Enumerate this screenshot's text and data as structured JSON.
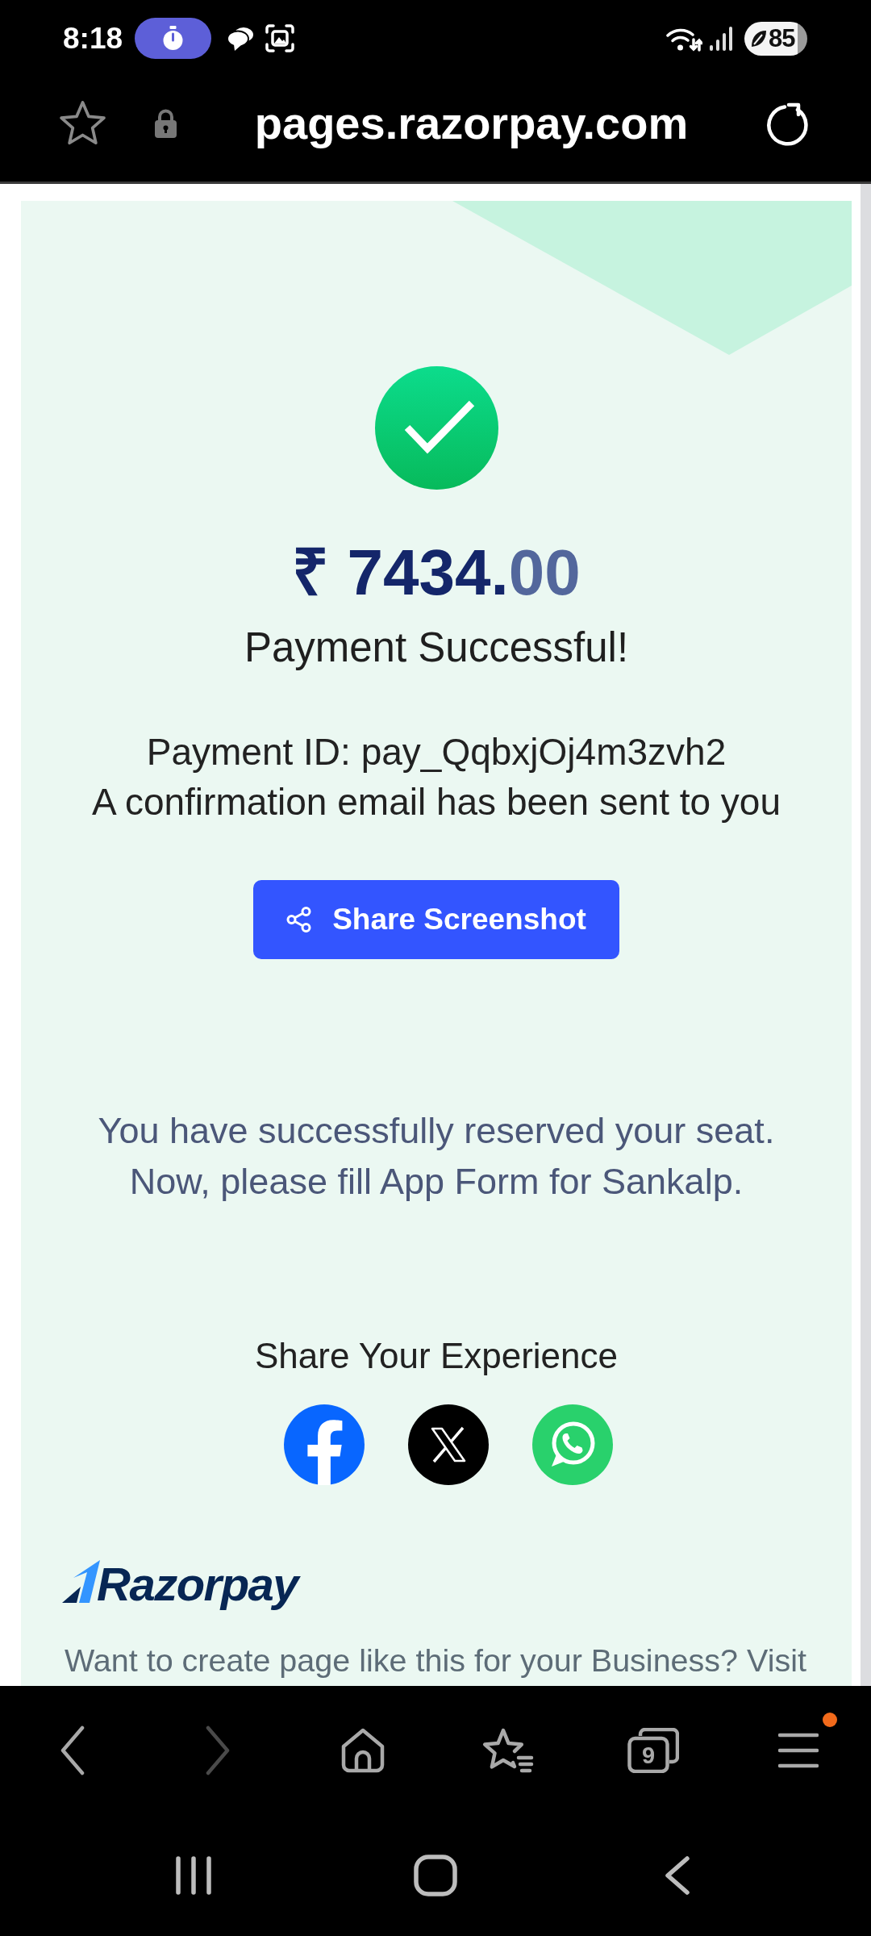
{
  "status_bar": {
    "time": "8:18",
    "battery": "85"
  },
  "address_bar": {
    "bookmarked": false,
    "url": "pages.razorpay.com"
  },
  "payment": {
    "amount": {
      "currency": "₹",
      "whole": "7434.",
      "fraction": "00"
    },
    "status": "Payment Successful!",
    "payment_id": "Payment ID: pay_QqbxjOj4m3zvh2",
    "note": "A confirmation email has been sent to you",
    "share_button": "Share Screenshot",
    "message": [
      "You have successfully reserved your seat.",
      "Now, please fill App Form for Sankalp."
    ],
    "share_heading": "Share Your Experience",
    "share_links": [
      {
        "kind": "facebook"
      },
      {
        "kind": "x"
      },
      {
        "kind": "whatsapp"
      }
    ],
    "brand": "Razorpay",
    "footer_text": "Want to create page like this for your Business? Visit"
  },
  "toolbar": {
    "items": [
      {
        "kind": "back",
        "disabled": false
      },
      {
        "kind": "forward",
        "disabled": true
      },
      {
        "kind": "home",
        "disabled": false
      },
      {
        "kind": "bookmarks",
        "disabled": false
      },
      {
        "kind": "tabs",
        "count": "9",
        "disabled": false
      },
      {
        "kind": "menu",
        "notification": true,
        "disabled": false
      }
    ]
  }
}
